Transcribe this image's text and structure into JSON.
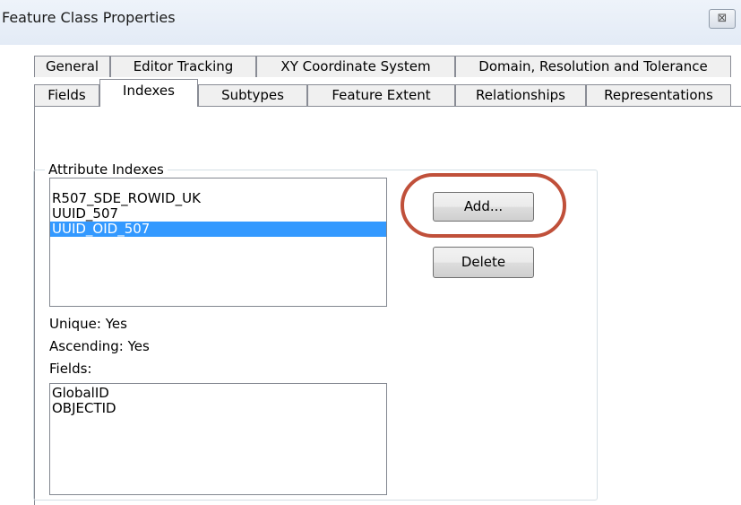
{
  "window": {
    "title": "Feature Class Properties",
    "close_glyph": "⊠"
  },
  "tabs": {
    "row1": [
      "General",
      "Editor Tracking",
      "XY Coordinate System",
      "Domain, Resolution and Tolerance"
    ],
    "row2": [
      "Fields",
      "Indexes",
      "Subtypes",
      "Feature Extent",
      "Relationships",
      "Representations"
    ],
    "active": "Indexes"
  },
  "attribute_indexes": {
    "legend": "Attribute Indexes",
    "items": [
      "R507_SDE_ROWID_UK",
      "UUID_507",
      "UUID_OID_507"
    ],
    "selected_index": 2
  },
  "buttons": {
    "add": "Add...",
    "delete": "Delete"
  },
  "index_details": {
    "unique": "Unique: Yes",
    "ascending": "Ascending: Yes",
    "fields_label": "Fields:",
    "fields": [
      "GlobalID",
      "OBJECTID"
    ]
  },
  "annotation_color": "#c0503a"
}
